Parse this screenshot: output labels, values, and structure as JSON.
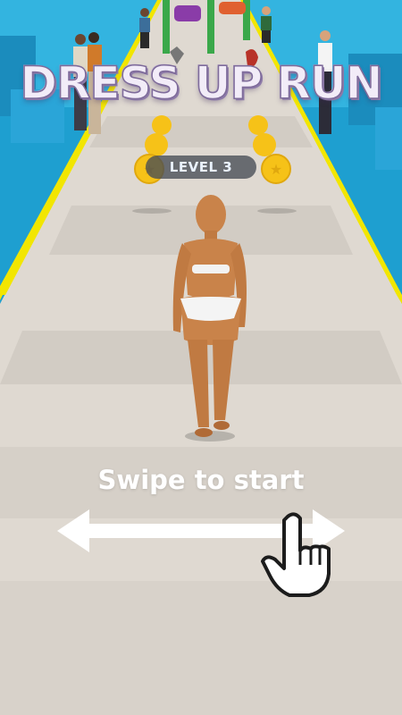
{
  "game": {
    "title": "DRESS UP RUN",
    "level_label": "LEVEL 3",
    "prompt": "Swipe to start"
  },
  "icons": {
    "arrow": "double-arrow-icon",
    "hand": "pointing-hand-icon",
    "coin": "star-coin-icon"
  },
  "colors": {
    "track": "#dcd6cf",
    "lane_line": "#f2e600",
    "water": "#1e9fd0",
    "coin": "#f6c218"
  }
}
